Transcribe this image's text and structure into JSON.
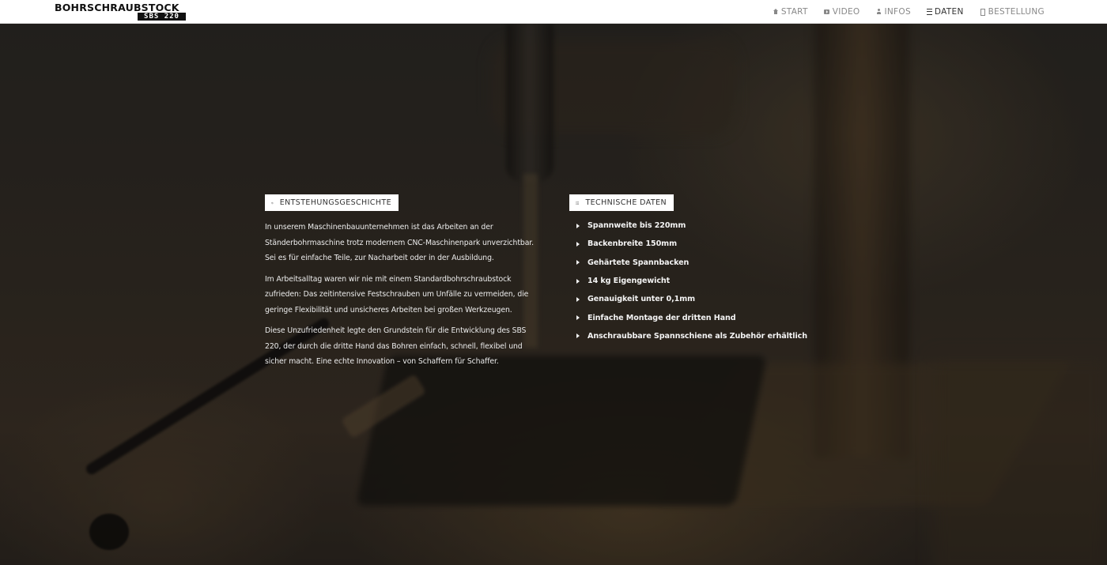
{
  "brand": {
    "name": "BOHRSCHRAUBSTOCK",
    "model": "SBS 220"
  },
  "nav": {
    "items": [
      {
        "label": "START",
        "icon": "home-icon",
        "active": false
      },
      {
        "label": "VIDEO",
        "icon": "video-icon",
        "active": false
      },
      {
        "label": "INFOS",
        "icon": "user-icon",
        "active": false
      },
      {
        "label": "DATEN",
        "icon": "list-icon",
        "active": true
      },
      {
        "label": "BESTELLUNG",
        "icon": "document-icon",
        "active": false
      }
    ]
  },
  "history": {
    "label": "ENTSTEHUNGSGESCHICHTE",
    "icon": "history-icon",
    "paragraphs": [
      "In unserem Maschinenbauunternehmen ist das Arbeiten an der Ständerbohrmaschine trotz modernem CNC-Maschinenpark unverzichtbar. Sei es für einfache Teile, zur Nacharbeit oder in der Ausbildung.",
      "Im Arbeitsalltag waren wir nie mit einem Standardbohrschraubstock zufrieden: Das zeitintensive Festschrauben um Unfälle zu vermeiden, die geringe Flexibilität und unsicheres Arbeiten bei großen Werkzeugen.",
      "Diese Unzufriedenheit legte den Grundstein für die Entwicklung des SBS 220, der durch die dritte Hand das Bohren einfach, schnell, flexibel und sicher macht. Eine echte Innovation – von Schaffern für Schaffer."
    ]
  },
  "tech": {
    "label": "TECHNISCHE DATEN",
    "icon": "list-icon",
    "items": [
      "Spannweite bis 220mm",
      "Backenbreite 150mm",
      "Gehärtete Spannbacken",
      "14 kg Eigengewicht",
      "Genauigkeit unter 0,1mm",
      "Einfache Montage der dritten Hand",
      "Anschraubbare Spannschiene als Zubehör erhältlich"
    ]
  },
  "colors": {
    "nav_background": "#ffffff",
    "nav_text": "#888888",
    "nav_active": "#333333",
    "hero_overlay": "#2b2824",
    "content_text": "#ececec"
  }
}
